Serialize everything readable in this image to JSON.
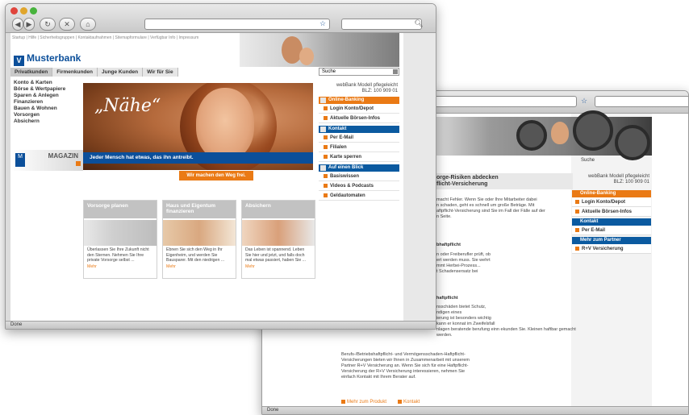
{
  "status": "Done",
  "back_window": {
    "status": "Done",
    "search_label": "Suche",
    "modell_text": "webBank Modell pflegeleicht",
    "blz": "BLZ: 100 909 01",
    "headline_1": "orge-Risiken abdecken",
    "headline_2": "flicht-Versicherung",
    "intro": [
      "macht Fehler. Wenn Sie oder Ihre Mitarbeiter dabei",
      "n schaden, geht es schnell um große Beträge. Mit",
      "aftpflicht-Versicherung sind Sie im Fall der Fälle auf der",
      "n Seite."
    ],
    "section_1_title": "bhaftpflicht",
    "section_1_text": [
      "n oder Freiberufler prüft, ob",
      "ert werden muss. Sie wehrt",
      "mmt Herbei-Prozess...",
      "t Schadensersatz bei"
    ],
    "section_2_title": "haftpflicht",
    "section_2_text": [
      "nsschäden bietet Schutz,",
      "ndigen eines",
      "ierung ist besonders wichtig",
      "kann er konnat im Zweifelsfall",
      "nlagen beratende berufung einn ekunden Sie. Kleinen haftbar gemacht",
      "werden."
    ],
    "bottom_text": [
      "Berufs-/Betriebshaftpflicht- und Vermögensschaden-Haftpflicht-",
      "Versicherungen bieten wir Ihnen in Zusammenarbeit mit unserem",
      "Partner R+V Versicherung an. Wenn Sie sich für eine Haftpflicht-",
      "Versicherung der R+V Versicherung interessieren, nehmen Sie",
      "einfach Kontakt mit Ihrem Berater auf."
    ],
    "foot_link_1": "Mehr zum Produkt",
    "foot_link_2": "Kontakt",
    "menu": {
      "online_banking": "Online-Banking",
      "login": "Login Konto/Depot",
      "aktuelle": "Aktuelle Börsen-Infos",
      "kontakt": "Kontakt",
      "email": "Per E-Mail",
      "mehr_partner": "Mehr zum Partner",
      "rv": "R+V Versicherung"
    }
  },
  "front_window": {
    "top_links": "Startup | Hilfe | Sicherheitsgruppen | Kontaktaufnahmen | Sitemapformulare | Verfügbar Info | Impressum",
    "logo_text": "Musterbank",
    "logo_mark": "V",
    "tabs": [
      "Privatkunden",
      "Firmenkunden",
      "Junge Kunden",
      "Wir für Sie"
    ],
    "search_placeholder": "Suche",
    "left_nav": [
      "Konto & Karten",
      "Börse & Wertpapiere",
      "Sparen & Anlegen",
      "Finanzieren",
      "Bauen & Wohnen",
      "Vorsorgen",
      "Absichern"
    ],
    "magazin_label": "MAGAZIN",
    "hero_quote": "„Nähe“",
    "hero_caption": "Jeder Mensch hat etwas, das ihn antreibt.",
    "hero_button": "Wir machen den Weg frei.",
    "modell_text": "webBank Modell pflegeleicht",
    "blz": "BLZ: 100 909 01",
    "right_menu": {
      "online_banking": "Online-Banking",
      "login": "Login Konto/Depot",
      "aktuelle": "Aktuelle Börsen-Infos",
      "kontakt": "Kontakt",
      "email": "Per E-Mail",
      "filialen": "Filialen",
      "karte": "Karte sperren",
      "auf_einen_blick": "Auf einen Blick",
      "basiswissen": "Basiswissen",
      "videos": "Videos & Podcasts",
      "geld": "Geldautomaten"
    },
    "cards": [
      {
        "title": "Vorsorge planen",
        "text": "Überlassen Sie Ihre Zukunft nicht den Sternen. Nehmen Sie Ihre private Vorsorge selbst ...",
        "more": "Mehr"
      },
      {
        "title": "Haus und Eigentum finanzieren",
        "text": "Ebnen Sie sich den Weg in Ihr Eigenheim, und werden Sie Bausparer. Mit den niedrigen ...",
        "more": "Mehr"
      },
      {
        "title": "Absichern",
        "text": "Das Leben ist spannend. Leben Sie hier und jetzt, und falls doch mal etwas passiert, haben Sie ...",
        "more": "Mehr"
      }
    ]
  }
}
